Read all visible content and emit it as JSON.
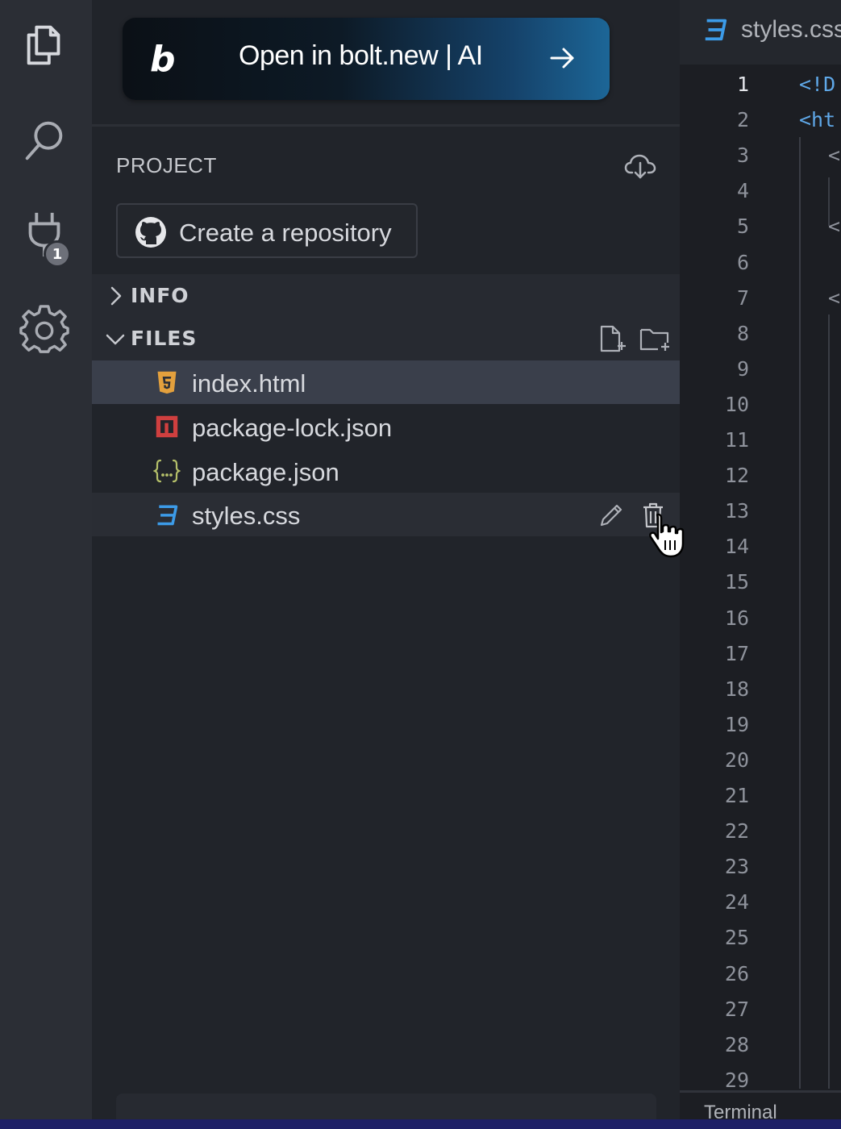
{
  "activity_bar": {
    "items": [
      {
        "name": "files-icon"
      },
      {
        "name": "search-icon"
      },
      {
        "name": "plug-icon",
        "badge": "1"
      },
      {
        "name": "settings-gear-icon"
      }
    ]
  },
  "bolt_button": {
    "logo": "b",
    "label": "Open in bolt.new | AI"
  },
  "project": {
    "title": "PROJECT",
    "repo_button_label": "Create a repository"
  },
  "sections": {
    "info": {
      "title": "INFO",
      "expanded": false
    },
    "files": {
      "title": "FILES",
      "expanded": true
    }
  },
  "files": [
    {
      "name": "index.html",
      "icon": "html5-icon",
      "icon_color": "#e3a03d",
      "state": "selected"
    },
    {
      "name": "package-lock.json",
      "icon": "npm-icon",
      "icon_color": "#cf3f3f",
      "state": "normal"
    },
    {
      "name": "package.json",
      "icon": "json-braces-icon",
      "icon_color": "#b5c06a",
      "state": "normal"
    },
    {
      "name": "styles.css",
      "icon": "css3-icon",
      "icon_color": "#3c9be8",
      "state": "hover"
    }
  ],
  "editor": {
    "tab_label": "styles.css",
    "current_line": 1,
    "line_numbers": [
      "1",
      "2",
      "3",
      "4",
      "5",
      "6",
      "7",
      "8",
      "9",
      "10",
      "11",
      "12",
      "13",
      "14",
      "15",
      "16",
      "17",
      "18",
      "19",
      "20",
      "21",
      "22",
      "23",
      "24",
      "25",
      "26",
      "27",
      "28",
      "29"
    ],
    "code_fragments": [
      {
        "line": 1,
        "text": "<!D"
      },
      {
        "line": 2,
        "text": "<ht"
      },
      {
        "line": 3,
        "text": "<"
      },
      {
        "line": 5,
        "text": "<"
      },
      {
        "line": 7,
        "text": "<"
      }
    ],
    "bottom_label": "Terminal"
  },
  "colors": {
    "accent_blue": "#3c9be8",
    "sidebar_bg": "#21242a",
    "selected_row": "#3a3f4b"
  }
}
